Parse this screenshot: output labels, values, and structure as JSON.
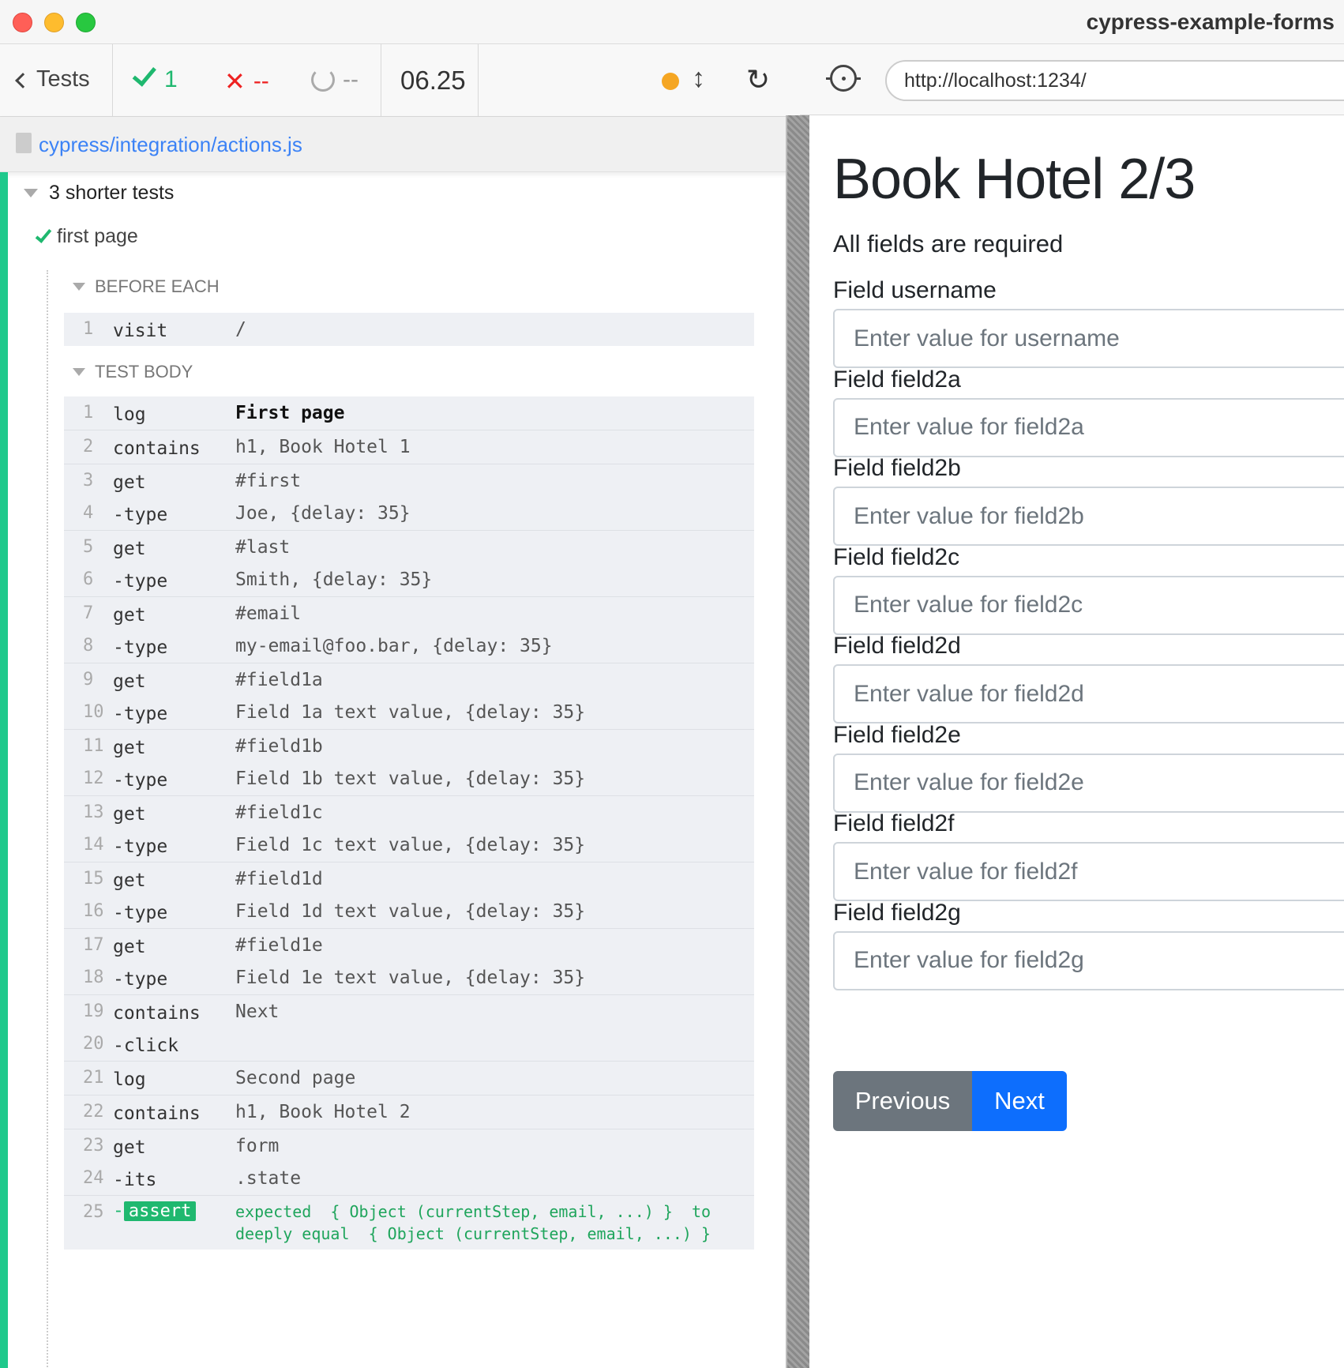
{
  "window": {
    "title": "cypress-example-forms"
  },
  "reporter": {
    "tests_label": "Tests",
    "passed": "1",
    "failed": "--",
    "pending": "--",
    "duration": "06.25",
    "spec_path": "cypress/integration/actions.js",
    "suite_title": "3 shorter tests",
    "test_title": "first page",
    "before_each": {
      "title": "BEFORE EACH",
      "commands": [
        {
          "num": "1",
          "name": "visit",
          "message": "/"
        }
      ]
    },
    "test_body": {
      "title": "TEST BODY",
      "commands": [
        {
          "num": "1",
          "name": "log",
          "message": "First page"
        },
        {
          "num": "2",
          "name": "contains",
          "message": "h1, Book Hotel 1"
        },
        {
          "num": "3",
          "name": "get",
          "message": "#first"
        },
        {
          "num": "4",
          "name": "-type",
          "message": "Joe, {delay: 35}"
        },
        {
          "num": "5",
          "name": "get",
          "message": "#last"
        },
        {
          "num": "6",
          "name": "-type",
          "message": "Smith, {delay: 35}"
        },
        {
          "num": "7",
          "name": "get",
          "message": "#email"
        },
        {
          "num": "8",
          "name": "-type",
          "message": "my-email@foo.bar, {delay: 35}"
        },
        {
          "num": "9",
          "name": "get",
          "message": "#field1a"
        },
        {
          "num": "10",
          "name": "-type",
          "message": "Field 1a text value, {delay: 35}"
        },
        {
          "num": "11",
          "name": "get",
          "message": "#field1b"
        },
        {
          "num": "12",
          "name": "-type",
          "message": "Field 1b text value, {delay: 35}"
        },
        {
          "num": "13",
          "name": "get",
          "message": "#field1c"
        },
        {
          "num": "14",
          "name": "-type",
          "message": "Field 1c text value, {delay: 35}"
        },
        {
          "num": "15",
          "name": "get",
          "message": "#field1d"
        },
        {
          "num": "16",
          "name": "-type",
          "message": "Field 1d text value, {delay: 35}"
        },
        {
          "num": "17",
          "name": "get",
          "message": "#field1e"
        },
        {
          "num": "18",
          "name": "-type",
          "message": "Field 1e text value, {delay: 35}"
        },
        {
          "num": "19",
          "name": "contains",
          "message": "Next"
        },
        {
          "num": "20",
          "name": "-click",
          "message": ""
        },
        {
          "num": "21",
          "name": "log",
          "message": "Second page"
        },
        {
          "num": "22",
          "name": "contains",
          "message": "h1, Book Hotel 2"
        },
        {
          "num": "23",
          "name": "get",
          "message": "form"
        },
        {
          "num": "24",
          "name": "-its",
          "message": ".state"
        }
      ],
      "assert": {
        "num": "25",
        "dash": "-",
        "name": "assert",
        "line1": "expected  { Object (currentStep, email, ...) }  to",
        "line2": "deeply equal  { Object (currentStep, email, ...) }"
      }
    }
  },
  "browser": {
    "url": "http://localhost:1234/"
  },
  "app": {
    "heading": "Book Hotel 2/3",
    "subtitle": "All fields are required",
    "fields": [
      {
        "label": "Field username",
        "placeholder": "Enter value for username"
      },
      {
        "label": "Field field2a",
        "placeholder": "Enter value for field2a"
      },
      {
        "label": "Field field2b",
        "placeholder": "Enter value for field2b"
      },
      {
        "label": "Field field2c",
        "placeholder": "Enter value for field2c"
      },
      {
        "label": "Field field2d",
        "placeholder": "Enter value for field2d"
      },
      {
        "label": "Field field2e",
        "placeholder": "Enter value for field2e"
      },
      {
        "label": "Field field2f",
        "placeholder": "Enter value for field2f"
      },
      {
        "label": "Field field2g",
        "placeholder": "Enter value for field2g"
      }
    ],
    "previous_label": "Previous",
    "next_label": "Next"
  },
  "colors": {
    "pass": "#1fb86f",
    "fail": "#ee2222",
    "link": "#3b82f6",
    "btn_secondary": "#6c757d",
    "btn_primary": "#0d6efd"
  }
}
